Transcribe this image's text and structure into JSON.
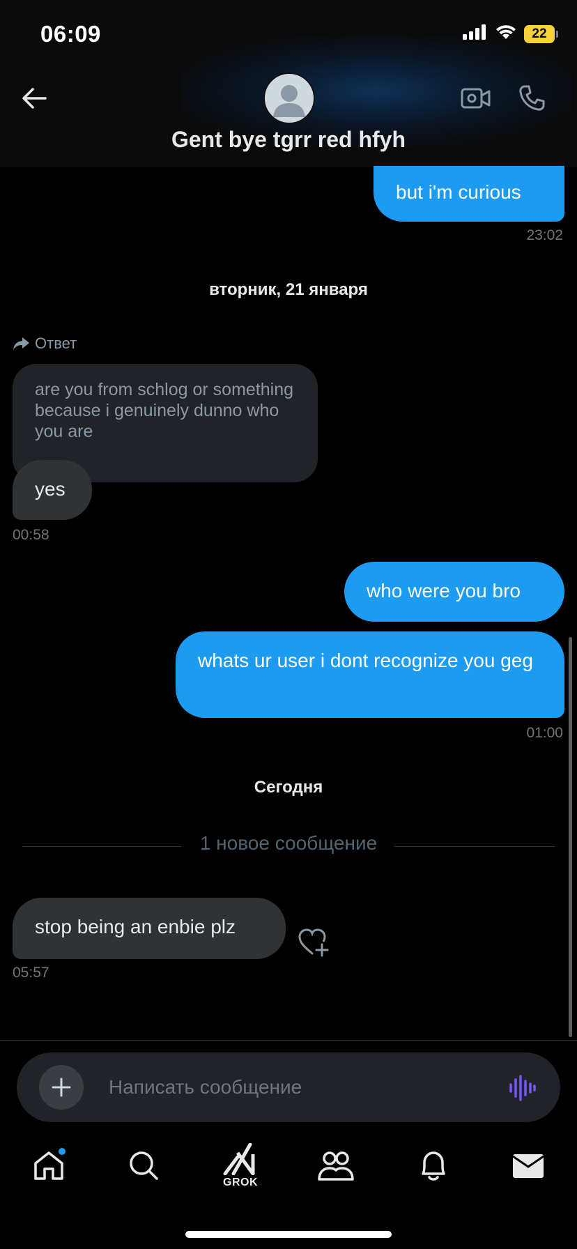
{
  "status_bar": {
    "time": "06:09",
    "battery": "22"
  },
  "header": {
    "title": "Gent bye tgrr red hfyh"
  },
  "messages": [
    {
      "text": "but i'm curious",
      "time": "23:02"
    },
    {
      "date_separator": "вторник, 21 января"
    },
    {
      "reply_label": "Ответ",
      "quoted": "are you from schlog or something because i genuinely dunno who you are",
      "text": "yes",
      "time": "00:58"
    },
    {
      "text": "who were you bro"
    },
    {
      "text": "whats ur user i dont recognize you geg",
      "time": "01:00"
    },
    {
      "date_separator": "Сегодня"
    },
    {
      "new_divider": "1 новое сообщение"
    },
    {
      "text": "stop being an enbie plz",
      "time": "05:57"
    }
  ],
  "composer": {
    "placeholder": "Написать сообщение"
  },
  "tabbar": {
    "grok_label": "GROK"
  },
  "colors": {
    "accent": "#1d9bf0",
    "incoming_bubble": "#2f3336",
    "background": "#000000",
    "voice_icon": "#7856ff",
    "battery": "#f7d33b"
  }
}
